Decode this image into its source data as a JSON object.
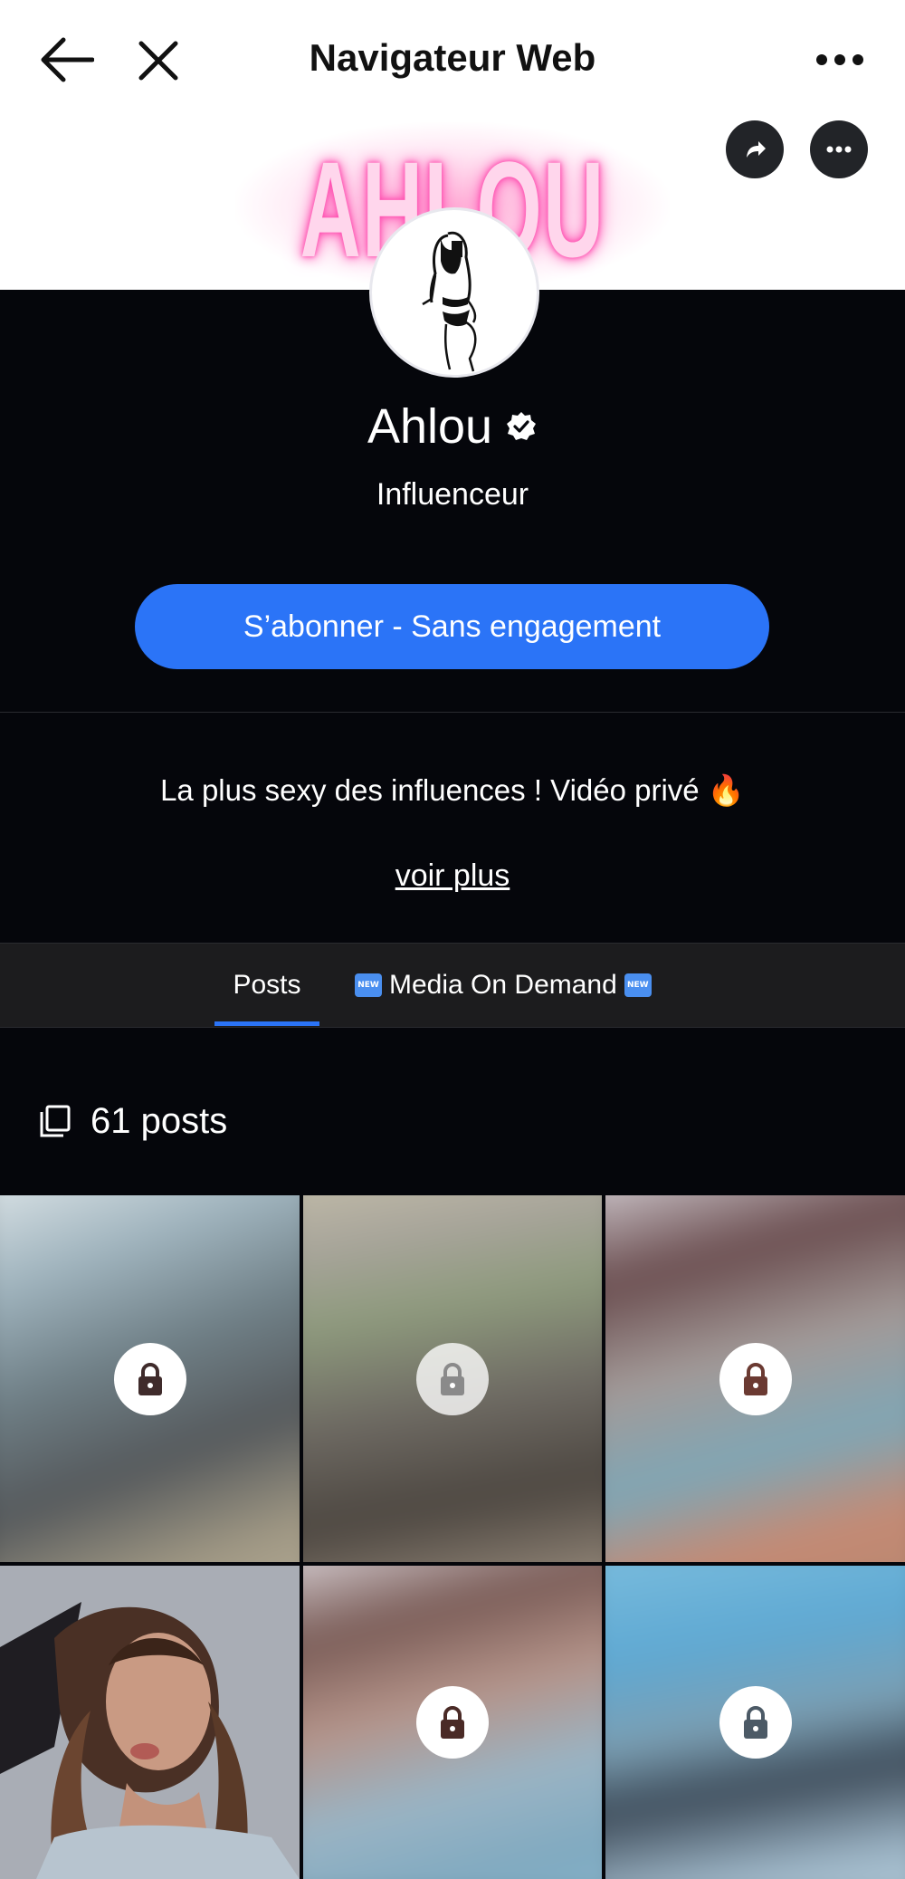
{
  "browser": {
    "title": "Navigateur Web"
  },
  "banner": {
    "neon_text": "AHLOU"
  },
  "profile": {
    "name": "Ahlou",
    "role": "Influenceur",
    "subscribe_label": "S’abonner - Sans engagement",
    "bio": "La plus sexy des influences ! Vidéo privé 🔥",
    "see_more": "voir plus"
  },
  "tabs": [
    {
      "label": "Posts",
      "active": true
    },
    {
      "label": "Media On Demand",
      "active": false,
      "badge": "NEW"
    }
  ],
  "posts": {
    "count_label": "61 posts",
    "items": [
      {
        "locked": true
      },
      {
        "locked": true
      },
      {
        "locked": true
      },
      {
        "locked": false
      },
      {
        "locked": true
      },
      {
        "locked": true
      }
    ]
  },
  "colors": {
    "accent": "#2b74f7",
    "background": "#05060b",
    "neon_pink": "#ff4fb0"
  }
}
